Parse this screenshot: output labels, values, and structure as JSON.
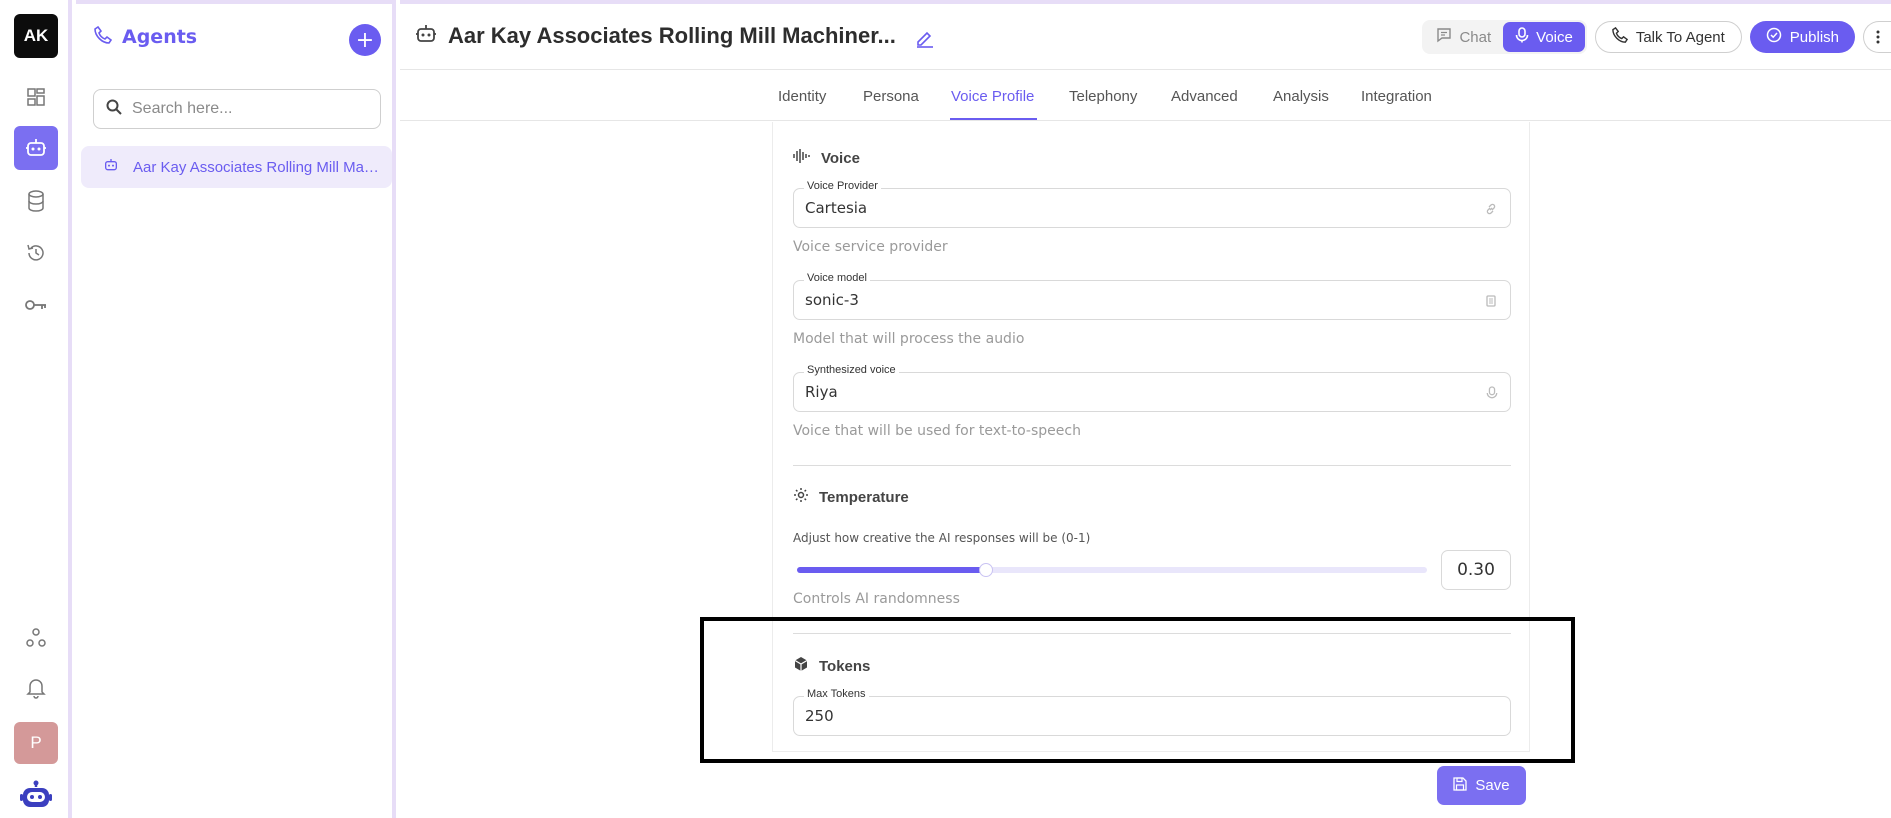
{
  "rail": {
    "logo_text": "AK",
    "icons": [
      "dashboard-icon",
      "robot-icon",
      "database-icon",
      "history-icon",
      "key-icon",
      "team-icon",
      "bell-icon",
      "bot-logo-icon"
    ],
    "avatar_letter": "P",
    "accent": "#7b6ff1"
  },
  "agents_panel": {
    "title": "Agents",
    "add_label": "+",
    "search_placeholder": "Search here...",
    "items": [
      {
        "label": "Aar Kay Associates Rolling Mill Machinery"
      }
    ]
  },
  "header": {
    "title": "Aar Kay Associates Rolling Mill Machiner...",
    "chat_label": "Chat",
    "voice_label": "Voice",
    "talk_label": "Talk To Agent",
    "publish_label": "Publish"
  },
  "tabs": [
    {
      "label": "Identity"
    },
    {
      "label": "Persona"
    },
    {
      "label": "Voice Profile",
      "active": true
    },
    {
      "label": "Telephony"
    },
    {
      "label": "Advanced"
    },
    {
      "label": "Analysis"
    },
    {
      "label": "Integration"
    }
  ],
  "voice_section": {
    "title": "Voice",
    "provider": {
      "label": "Voice Provider",
      "value": "Cartesia",
      "help": "Voice service provider"
    },
    "model": {
      "label": "Voice model",
      "value": "sonic-3",
      "help": "Model that will process the audio"
    },
    "synth": {
      "label": "Synthesized voice",
      "value": "Riya",
      "help": "Voice that will be used for text-to-speech"
    }
  },
  "temperature_section": {
    "title": "Temperature",
    "description": "Adjust how creative the AI responses will be (0-1)",
    "value": "0.30",
    "level": 0.3,
    "help": "Controls AI randomness"
  },
  "tokens_section": {
    "title": "Tokens",
    "max_tokens": {
      "label": "Max Tokens",
      "value": "250"
    }
  },
  "save_label": "Save",
  "colors": {
    "accent": "#6a5cf0",
    "border": "#e7ddf7"
  }
}
